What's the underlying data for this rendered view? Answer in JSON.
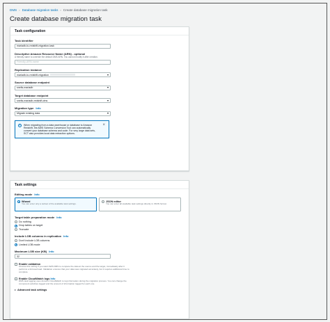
{
  "breadcrumb": {
    "items": [
      "DMS",
      "Database migration tasks",
      "Create database migration task"
    ]
  },
  "page_title": "Create database migration task",
  "task_config": {
    "header": "Task configuration",
    "task_identifier": {
      "label": "Task identifier",
      "value": "mariadb-to-redshift-migration-task"
    },
    "arn": {
      "label": "Descriptive Amazon Resource Name (ARN) - optional",
      "hint": "A friendly name to override the default DMS ARN. You cannot modify it after creation.",
      "placeholder": "Friendly-ARN-name"
    },
    "replication_instance": {
      "label": "Replication instance",
      "value": "mariadb-to-redshift-migration"
    },
    "source_endpoint": {
      "label": "Source database endpoint",
      "value": "snells-mariadb"
    },
    "target_endpoint": {
      "label": "Target database endpoint",
      "value": "snells-mariadb-redshift-dms"
    },
    "migration_type": {
      "label": "Migration type",
      "info": "Info",
      "value": "Migrate existing data"
    },
    "alert": {
      "text": "When migrating from a data warehouse or database to Amazon Redshift, the AWS Schema Conversion Tool can automatically convert your database schema and code. For very large data sets, SCT also provides local data extraction options."
    }
  },
  "task_settings": {
    "header": "Task settings",
    "editing_mode": {
      "label": "Editing mode",
      "info": "Info",
      "wizard": {
        "title": "Wizard",
        "desc": "You can enter only a subset of the available task settings."
      },
      "json": {
        "title": "JSON editor",
        "desc": "You can enter all available task settings directly in JSON format."
      }
    },
    "target_prep": {
      "label": "Target table preparation mode",
      "info": "Info",
      "options": [
        "Do nothing",
        "Drop tables on target",
        "Truncate"
      ]
    },
    "lob": {
      "label": "Include LOB columns in replication",
      "info": "Info",
      "options": [
        "Don't include LOB columns",
        "Limited LOB mode"
      ]
    },
    "max_lob": {
      "label": "Maximum LOB size (KB)",
      "info": "Info",
      "value": "32"
    },
    "validation": {
      "title": "Enable validation",
      "desc": "Choose this setting if you want AWS DMS to compare the data at the source and the target, immediately after it performs a full-load load. Validation ensures that your data was migrated accurately, but it requires additional time to complete."
    },
    "cloudwatch": {
      "title": "Enable CloudWatch logs",
      "info": "Info",
      "desc": "DMS task logging uses Amazon CloudWatch to log information during the migration process. You can change the component activities logged and the amount of information logged for each one."
    },
    "advanced": "Advanced task settings"
  }
}
